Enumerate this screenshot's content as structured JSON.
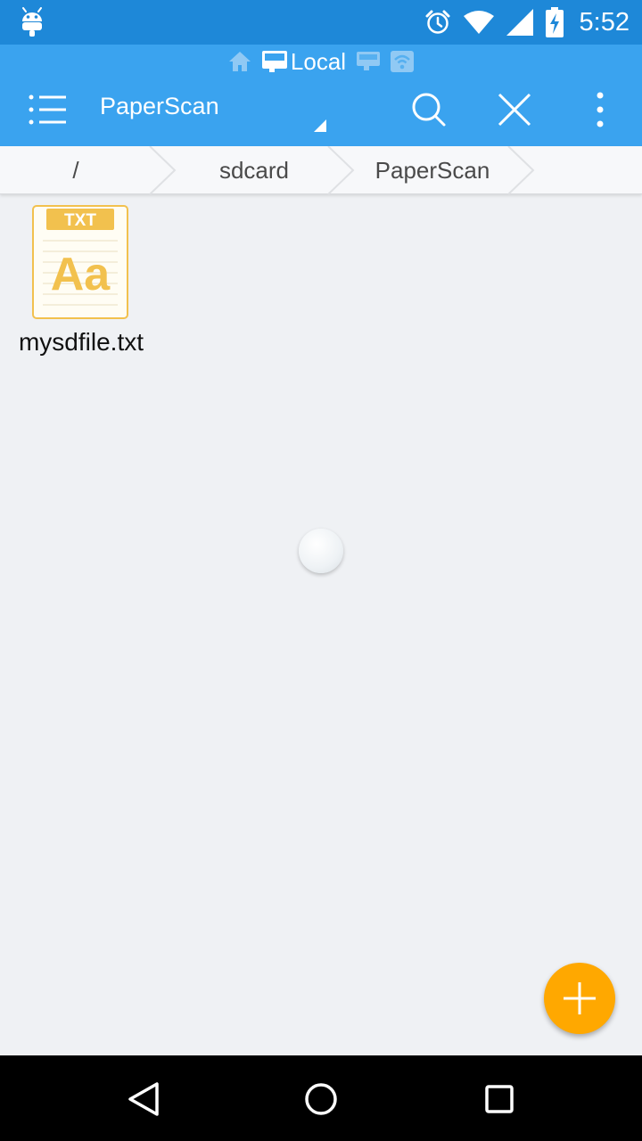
{
  "status_bar": {
    "time": "5:52",
    "icons": [
      "android-debug-icon",
      "alarm-icon",
      "wifi-icon",
      "signal-icon",
      "battery-charging-icon"
    ]
  },
  "toolbar": {
    "source_label": "Local",
    "source_icons": [
      "home-icon",
      "sd-card-icon",
      "network-icon",
      "wifi-share-icon"
    ],
    "title": "PaperScan",
    "actions": [
      "menu-icon",
      "search-icon",
      "close-icon",
      "more-vert-icon"
    ]
  },
  "breadcrumb": {
    "items": [
      "/",
      "sdcard",
      "PaperScan"
    ]
  },
  "files": [
    {
      "name": "mysdfile.txt",
      "type_badge": "TXT",
      "glyph": "Aa"
    }
  ],
  "fab": {
    "icon": "plus-icon"
  },
  "colors": {
    "status_bar": "#1e88d8",
    "toolbar": "#3aa3ef",
    "background": "#eff1f4",
    "txt_accent": "#f2c14e",
    "fab": "#ffa800"
  },
  "nav_bar": {
    "buttons": [
      "back-icon",
      "home-icon",
      "recents-icon"
    ]
  }
}
